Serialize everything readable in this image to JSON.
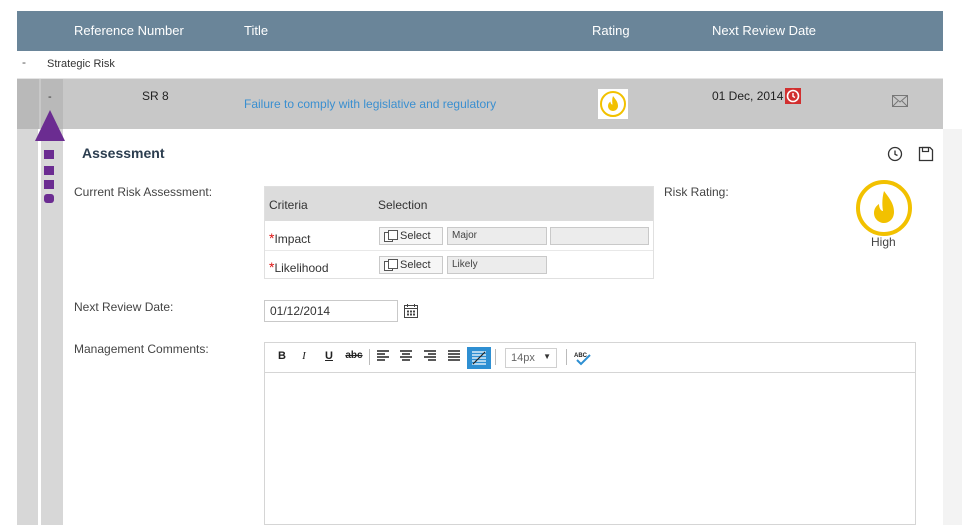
{
  "grid": {
    "headers": {
      "reference": "Reference Number",
      "title": "Title",
      "rating": "Rating",
      "next_review": "Next Review Date"
    },
    "group": {
      "toggle": "-",
      "label": "Strategic Risk"
    },
    "row": {
      "toggle": "-",
      "reference": "SR 8",
      "title": "Failure to comply with legislative and regulatory",
      "rating_icon": "fire-icon",
      "next_review": "01 Dec, 2014"
    }
  },
  "assessment": {
    "title": "Assessment",
    "current_label": "Current Risk Assessment:",
    "criteria_headers": {
      "criteria": "Criteria",
      "selection": "Selection"
    },
    "criteria": [
      {
        "required": "*",
        "name": "Impact",
        "button": "Select",
        "value": "Major",
        "extra": ""
      },
      {
        "required": "*",
        "name": "Likelihood",
        "button": "Select",
        "value": "Likely"
      }
    ],
    "risk_rating_label": "Risk Rating:",
    "risk_level": "High",
    "next_review_label": "Next Review Date:",
    "next_review_value": "01/12/2014",
    "comments_label": "Management Comments:",
    "editor": {
      "bold": "B",
      "italic": "I",
      "underline": "U",
      "strike": "abc",
      "font_size": "14px",
      "spell": "ABC"
    }
  },
  "colors": {
    "header_bg": "#6a8599",
    "link": "#3a8fd0",
    "accent_purple": "#6b2c91",
    "rating_yellow": "#f2c100",
    "clock_red": "#d12f2f",
    "toolbar_active": "#2e8fd2"
  }
}
